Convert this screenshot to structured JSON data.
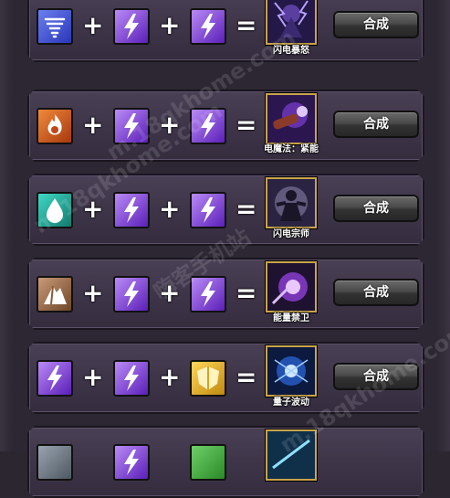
{
  "recipes": [
    {
      "ingredients": [
        "whirlwind",
        "lightning",
        "lightning"
      ],
      "result": "闪电暴怒",
      "button": "合成"
    },
    {
      "ingredients": [
        "fire",
        "lightning",
        "lightning"
      ],
      "result": "电魔法：紧能",
      "button": "合成"
    },
    {
      "ingredients": [
        "water",
        "lightning",
        "lightning"
      ],
      "result": "闪电宗师",
      "button": "合成"
    },
    {
      "ingredients": [
        "earth",
        "lightning",
        "lightning"
      ],
      "result": "能量禁卫",
      "button": "合成"
    },
    {
      "ingredients": [
        "lightning",
        "lightning",
        "gold"
      ],
      "result": "量子波动",
      "button": "合成"
    },
    {
      "ingredients": [
        "unknown",
        "lightning",
        "unknown"
      ],
      "result": "",
      "button": ""
    }
  ],
  "operators": {
    "plus": "+",
    "equals": "="
  },
  "watermarks": [
    "m.18qkhome.com",
    "m.18qkhome.com",
    "嗨客手机站",
    "m.18qkhome.com"
  ],
  "colors": {
    "lightning_gem": "#7a3fd6",
    "whirlwind_gem": "#3a4fd0",
    "fire_gem": "#d35a1a",
    "water_gem": "#2aa89a",
    "earth_gem": "#a2734c",
    "gold_gem": "#e6b421",
    "result_border": "#c9a44a"
  }
}
